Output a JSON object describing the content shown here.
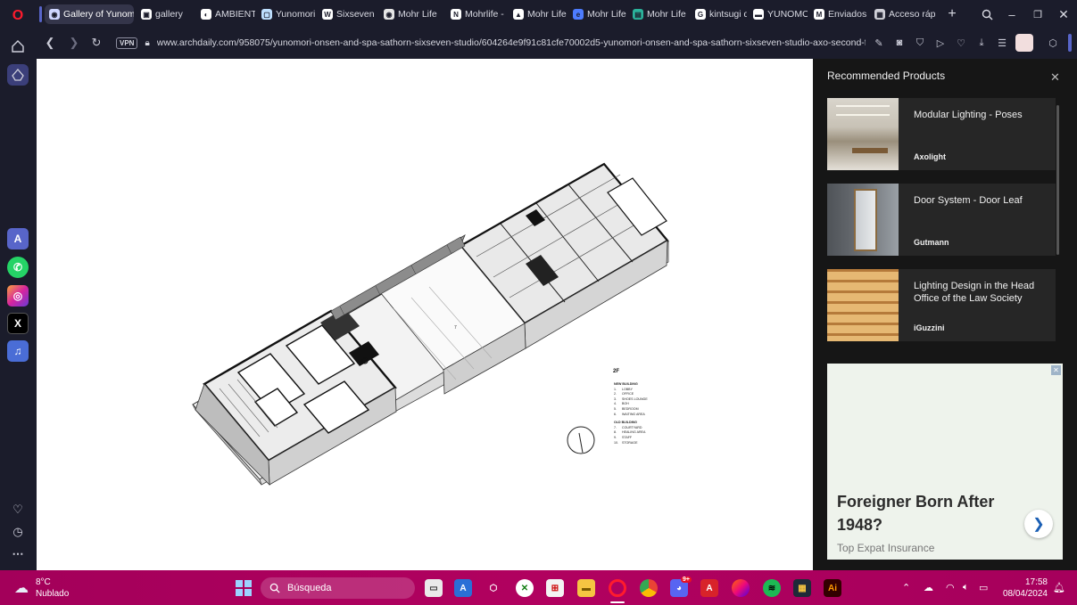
{
  "tabs": [
    {
      "label": "Gallery of Yunomo",
      "icon": "archdaily-icon",
      "active": true
    },
    {
      "label": "gallery",
      "icon": "gallery-icon"
    },
    {
      "label": "AMBIENTE",
      "icon": "ambiente-icon"
    },
    {
      "label": "Yunomori",
      "icon": "yunomori-icon"
    },
    {
      "label": "Sixseven S",
      "icon": "w-icon"
    },
    {
      "label": "Mohr Life",
      "icon": "mohr-icon"
    },
    {
      "label": "Mohrlife -",
      "icon": "mohrlife-icon"
    },
    {
      "label": "Mohr Life.",
      "icon": "mohr-triangle-icon"
    },
    {
      "label": "Mohr Life",
      "icon": "mohr-e-icon"
    },
    {
      "label": "Mohr Life",
      "icon": "mohr-doc-icon"
    },
    {
      "label": "kintsugi d",
      "icon": "google-icon"
    },
    {
      "label": "YUNOMO",
      "icon": "yunomo-icon"
    },
    {
      "label": "Enviados",
      "icon": "gmail-icon"
    },
    {
      "label": "Acceso ráp",
      "icon": "grid-icon"
    }
  ],
  "address": {
    "vpn": "VPN",
    "url": "www.archdaily.com/958075/yunomori-onsen-and-spa-sathorn-sixseven-studio/604264e9f91c81cfe70002d5-yunomori-onsen-and-spa-sathorn-sixseven-studio-axo-second-fl"
  },
  "drawing": {
    "floor": "2F",
    "new_building_title": "NEW BUILDING",
    "new_building_items": [
      "1.      LOBBY",
      "2.      OFFICE",
      "3.      SHOES LOUNGE",
      "4.      BOH",
      "5.      BEDROOM",
      "6.      WAITING AREA"
    ],
    "old_building_title": "OLD BUILDING",
    "old_building_items": [
      "7.      COURTYARD",
      "8.      HEALING AREA",
      "9.      STAFF",
      "10.    STORAGE"
    ]
  },
  "panel": {
    "title": "Recommended Products",
    "products": [
      {
        "title": "Modular Lighting - Poses",
        "brand": "Axolight"
      },
      {
        "title": "Door System - Door Leaf",
        "brand": "Gutmann"
      },
      {
        "title": "Lighting Design in the Head Office of the Law Society",
        "brand": "iGuzzini"
      }
    ],
    "ad": {
      "headline": "Foreigner Born After 1948?",
      "sponsor": "Top Expat Insurance"
    }
  },
  "taskbar": {
    "weather_temp": "8°C",
    "weather_desc": "Nublado",
    "search_placeholder": "Búsqueda",
    "time": "17:58",
    "date": "08/04/2024",
    "discord_badge": "9+"
  },
  "colors": {
    "sidebar_bg": "#1b1c2b",
    "taskbar_bg": "#b1015f",
    "panel_bg": "#161616"
  }
}
